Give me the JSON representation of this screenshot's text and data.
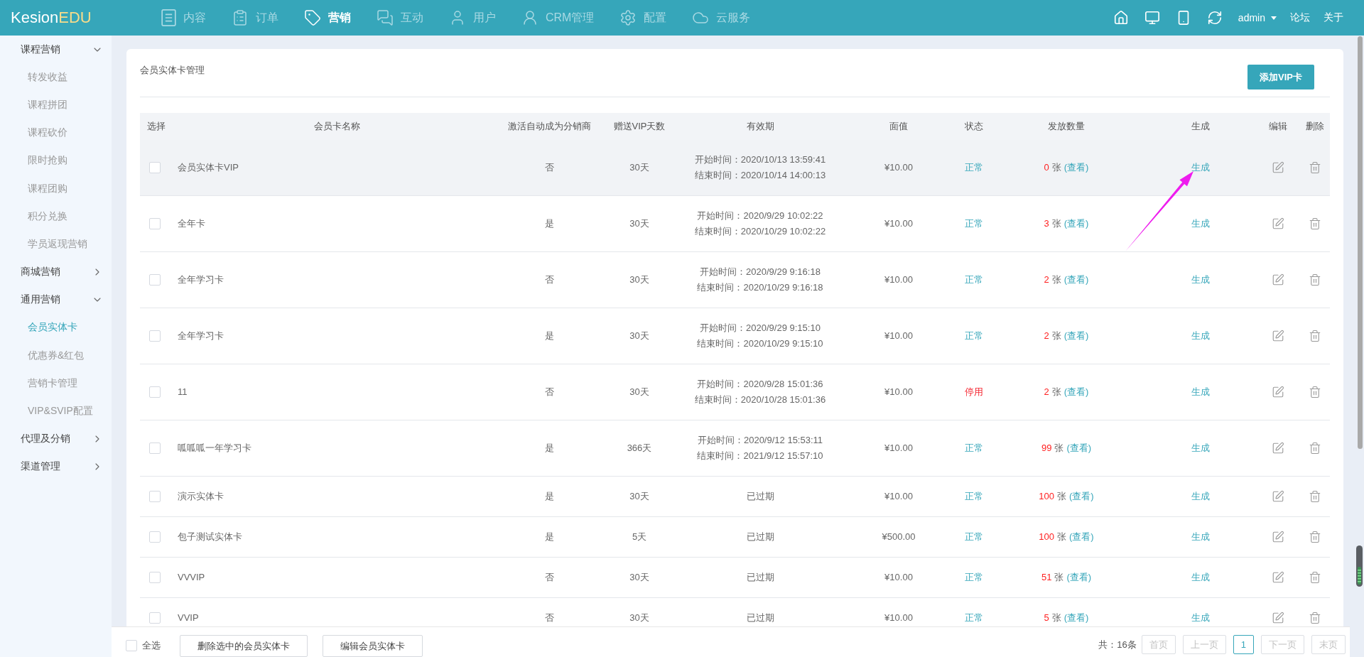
{
  "topbar": {
    "logo": {
      "primary": "Kesion",
      "accent": "EDU"
    },
    "nav": [
      {
        "label": "内容",
        "selected": false
      },
      {
        "label": "订单",
        "selected": false
      },
      {
        "label": "营销",
        "selected": true
      },
      {
        "label": "互动",
        "selected": false
      },
      {
        "label": "用户",
        "selected": false
      },
      {
        "label": "CRM管理",
        "selected": false
      },
      {
        "label": "配置",
        "selected": false
      },
      {
        "label": "云服务",
        "selected": false
      }
    ],
    "user": "admin",
    "links": [
      "论坛",
      "关于"
    ]
  },
  "sidebar": {
    "groups": [
      {
        "label": "课程营销",
        "expanded": true,
        "children": [
          {
            "label": "转发收益",
            "selected": false
          },
          {
            "label": "课程拼团",
            "selected": false
          },
          {
            "label": "课程砍价",
            "selected": false
          },
          {
            "label": "限时抢购",
            "selected": false
          },
          {
            "label": "课程团购",
            "selected": false
          },
          {
            "label": "积分兑换",
            "selected": false
          },
          {
            "label": "学员返现营销",
            "selected": false
          }
        ]
      },
      {
        "label": "商城营销",
        "expanded": false
      },
      {
        "label": "通用营销",
        "expanded": true,
        "children": [
          {
            "label": "会员实体卡",
            "selected": true
          },
          {
            "label": "优惠券&红包",
            "selected": false
          },
          {
            "label": "营销卡管理",
            "selected": false
          },
          {
            "label": "VIP&SVIP配置",
            "selected": false
          }
        ]
      },
      {
        "label": "代理及分销",
        "expanded": false
      },
      {
        "label": "渠道管理",
        "expanded": false
      }
    ]
  },
  "panel": {
    "title": "会员实体卡管理",
    "add_button": "添加VIP卡"
  },
  "table": {
    "columns": [
      "选择",
      "会员卡名称",
      "激活自动成为分销商",
      "赠送VIP天数",
      "有效期",
      "面值",
      "状态",
      "发放数量",
      "生成",
      "编辑",
      "删除"
    ],
    "rows": [
      {
        "checked": false,
        "hovered": true,
        "name": "会员实体卡VIP",
        "auto_distributor": "否",
        "vip_days": "30天",
        "validity": {
          "kind": "range",
          "start": "开始时间：2020/10/13 13:59:41",
          "end": "结束时间：2020/10/14 14:00:13"
        },
        "face_value": "¥10.00",
        "status": {
          "label": "正常",
          "kind": "normal"
        },
        "issued": {
          "count": "0",
          "unit": "张",
          "link": "(查看)"
        },
        "generate": "生成"
      },
      {
        "checked": false,
        "hovered": false,
        "name": "全年卡",
        "auto_distributor": "是",
        "vip_days": "30天",
        "validity": {
          "kind": "range",
          "start": "开始时间：2020/9/29 10:02:22",
          "end": "结束时间：2020/10/29 10:02:22"
        },
        "face_value": "¥10.00",
        "status": {
          "label": "正常",
          "kind": "normal"
        },
        "issued": {
          "count": "3",
          "unit": "张",
          "link": "(查看)"
        },
        "generate": "生成"
      },
      {
        "checked": false,
        "hovered": false,
        "name": "全年学习卡",
        "auto_distributor": "否",
        "vip_days": "30天",
        "validity": {
          "kind": "range",
          "start": "开始时间：2020/9/29 9:16:18",
          "end": "结束时间：2020/10/29 9:16:18"
        },
        "face_value": "¥10.00",
        "status": {
          "label": "正常",
          "kind": "normal"
        },
        "issued": {
          "count": "2",
          "unit": "张",
          "link": "(查看)"
        },
        "generate": "生成"
      },
      {
        "checked": false,
        "hovered": false,
        "name": "全年学习卡",
        "auto_distributor": "是",
        "vip_days": "30天",
        "validity": {
          "kind": "range",
          "start": "开始时间：2020/9/29 9:15:10",
          "end": "结束时间：2020/10/29 9:15:10"
        },
        "face_value": "¥10.00",
        "status": {
          "label": "正常",
          "kind": "normal"
        },
        "issued": {
          "count": "2",
          "unit": "张",
          "link": "(查看)"
        },
        "generate": "生成"
      },
      {
        "checked": false,
        "hovered": false,
        "name": "11",
        "auto_distributor": "否",
        "vip_days": "30天",
        "validity": {
          "kind": "range",
          "start": "开始时间：2020/9/28 15:01:36",
          "end": "结束时间：2020/10/28 15:01:36"
        },
        "face_value": "¥10.00",
        "status": {
          "label": "停用",
          "kind": "stopped"
        },
        "issued": {
          "count": "2",
          "unit": "张",
          "link": "(查看)"
        },
        "generate": "生成"
      },
      {
        "checked": false,
        "hovered": false,
        "name": "呱呱呱一年学习卡",
        "auto_distributor": "是",
        "vip_days": "366天",
        "validity": {
          "kind": "range",
          "start": "开始时间：2020/9/12 15:53:11",
          "end": "结束时间：2021/9/12 15:57:10"
        },
        "face_value": "¥10.00",
        "status": {
          "label": "正常",
          "kind": "normal"
        },
        "issued": {
          "count": "99",
          "unit": "张",
          "link": "(查看)"
        },
        "generate": "生成"
      },
      {
        "checked": false,
        "hovered": false,
        "name": "演示实体卡",
        "auto_distributor": "是",
        "vip_days": "30天",
        "validity": {
          "kind": "expired",
          "text": "已过期"
        },
        "face_value": "¥10.00",
        "status": {
          "label": "正常",
          "kind": "normal"
        },
        "issued": {
          "count": "100",
          "unit": "张",
          "link": "(查看)"
        },
        "generate": "生成"
      },
      {
        "checked": false,
        "hovered": false,
        "name": "包子测试实体卡",
        "auto_distributor": "是",
        "vip_days": "5天",
        "validity": {
          "kind": "expired",
          "text": "已过期"
        },
        "face_value": "¥500.00",
        "status": {
          "label": "正常",
          "kind": "normal"
        },
        "issued": {
          "count": "100",
          "unit": "张",
          "link": "(查看)"
        },
        "generate": "生成"
      },
      {
        "checked": false,
        "hovered": false,
        "name": "VVVIP",
        "auto_distributor": "否",
        "vip_days": "30天",
        "validity": {
          "kind": "expired",
          "text": "已过期"
        },
        "face_value": "¥10.00",
        "status": {
          "label": "正常",
          "kind": "normal"
        },
        "issued": {
          "count": "51",
          "unit": "张",
          "link": "(查看)"
        },
        "generate": "生成"
      },
      {
        "checked": false,
        "hovered": false,
        "name": "VVIP",
        "auto_distributor": "否",
        "vip_days": "30天",
        "validity": {
          "kind": "expired",
          "text": "已过期"
        },
        "face_value": "¥10.00",
        "status": {
          "label": "正常",
          "kind": "normal"
        },
        "issued": {
          "count": "5",
          "unit": "张",
          "link": "(查看)"
        },
        "generate": "生成"
      }
    ]
  },
  "footer": {
    "select_all": {
      "label": "全选",
      "checked": false
    },
    "buttons": [
      "删除选中的会员实体卡",
      "编辑会员实体卡"
    ],
    "pagination": {
      "total": "共：16条",
      "first": {
        "label": "首页",
        "disabled": true
      },
      "prev": {
        "label": "上一页",
        "disabled": true
      },
      "pages": [
        {
          "label": "1",
          "selected": true
        }
      ],
      "next": {
        "label": "下一页",
        "disabled": true
      },
      "last": {
        "label": "末页",
        "disabled": true
      }
    }
  }
}
